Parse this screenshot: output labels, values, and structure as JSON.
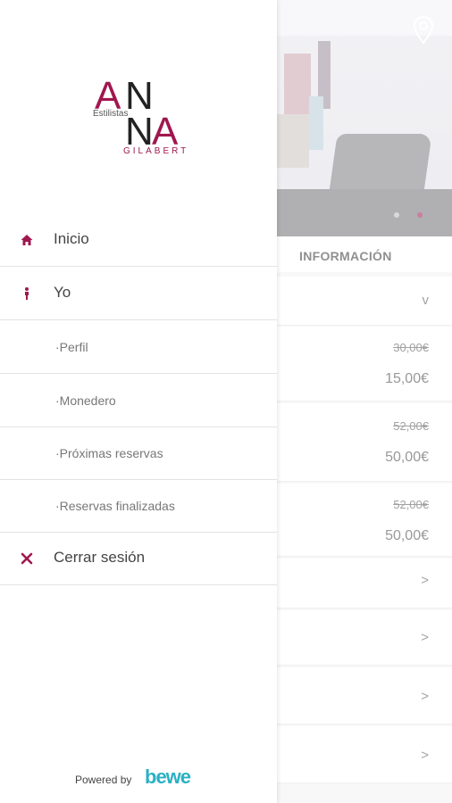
{
  "drawer": {
    "logo": {
      "letter_a": "A",
      "letter_n": "N",
      "subtitle": "Estilistas",
      "surname": "GILABERT"
    },
    "menu": [
      {
        "label": "Inicio",
        "icon": "home-icon"
      },
      {
        "label": "Yo",
        "icon": "person-icon"
      },
      {
        "label": "·Perfil",
        "icon": ""
      },
      {
        "label": "·Monedero",
        "icon": ""
      },
      {
        "label": "·Próximas reservas",
        "icon": ""
      },
      {
        "label": "·Reservas finalizadas",
        "icon": ""
      },
      {
        "label": "Cerrar sesión",
        "icon": "close-icon"
      }
    ],
    "footer": {
      "powered_by": "Powered by",
      "brand": "bewe"
    }
  },
  "background": {
    "tab_label": "INFORMACIÓN",
    "services": [
      {
        "old_price": "30,00€",
        "new_price": "15,00€"
      },
      {
        "old_price": "52,00€",
        "new_price": "50,00€"
      },
      {
        "old_price": "52,00€",
        "new_price": "50,00€"
      }
    ],
    "collapse_chevron": "v",
    "row_chevron": ">"
  },
  "colors": {
    "accent": "#a0174f",
    "brand": "#2ab0c4"
  }
}
